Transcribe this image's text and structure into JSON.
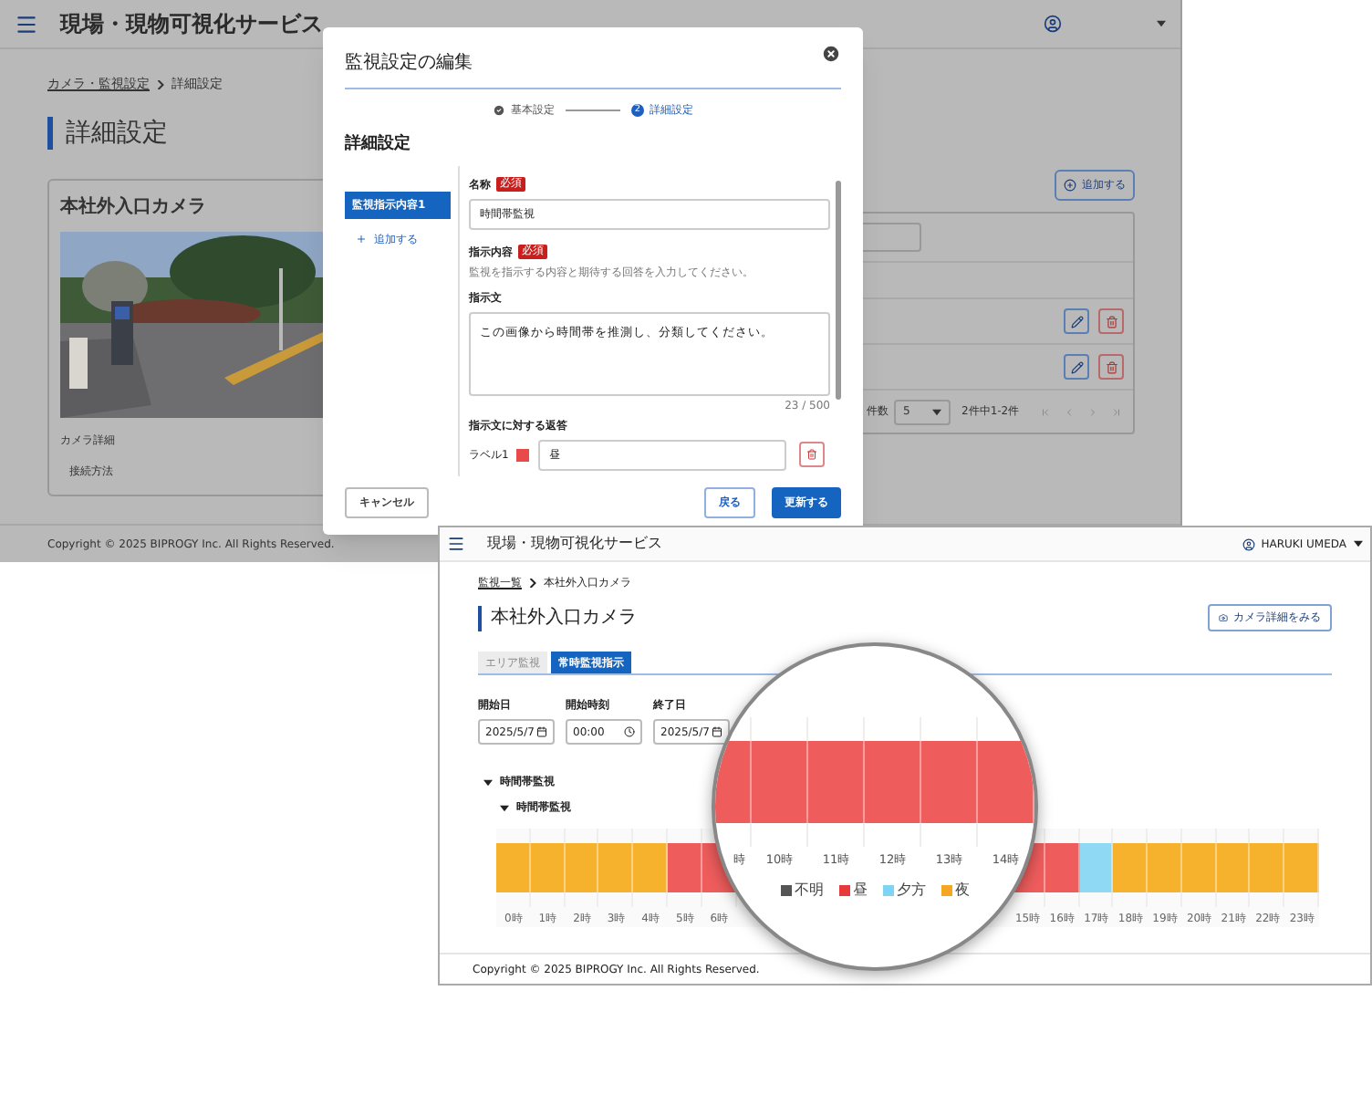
{
  "back_window": {
    "title": "現場・現物可視化サービス",
    "breadcrumb": [
      {
        "label": "カメラ・監視設定",
        "link": true
      },
      {
        "label": "詳細設定",
        "link": false
      }
    ],
    "page_title": "詳細設定",
    "camera_card": {
      "title": "本社外入口カメラ",
      "section": "カメラ詳細",
      "field": "接続方法"
    },
    "add_button": "追加する",
    "rows": [
      {
        "kind": "item"
      },
      {
        "kind": "item"
      }
    ],
    "pagination": {
      "label": "件数",
      "page_size": "5",
      "range": "2件中1-2件"
    },
    "footer": "Copyright © 2025 BIPROGY Inc. All Rights Reserved."
  },
  "dialog": {
    "title": "監視設定の編集",
    "steps": [
      {
        "label": "基本設定",
        "done": true,
        "selected": false
      },
      {
        "label": "詳細設定",
        "number": "2",
        "done": false,
        "selected": true
      }
    ],
    "section_title": "詳細設定",
    "items": [
      {
        "label": "監視指示内容1",
        "selected": true
      }
    ],
    "add_item": "追加する",
    "name_label": "名称",
    "required": "必須",
    "name_value": "時間帯監視",
    "instruction_label": "指示内容",
    "instruction_required": "必須",
    "instruction_hint": "監視を指示する内容と期待する回答を入力してください。",
    "prompt_label": "指示文",
    "prompt_value": "この画像から時間帯を推測し、分類してください。",
    "counter": "23 / 500",
    "answers_label": "指示文に対する返答",
    "answers": [
      {
        "label": "ラベル1",
        "color": "#e84a4a",
        "value": "昼"
      }
    ],
    "buttons": [
      {
        "label": "キャンセル",
        "kind": "outline"
      },
      {
        "label": "戻る",
        "kind": "secondary"
      },
      {
        "label": "更新する",
        "kind": "primary"
      }
    ]
  },
  "front_window": {
    "title": "現場・現物可視化サービス",
    "user": "HARUKI UMEDA",
    "breadcrumb": [
      {
        "label": "監視一覧",
        "link": true
      },
      {
        "label": "本社外入口カメラ",
        "link": false
      }
    ],
    "page_title": "本社外入口カメラ",
    "detail_button": "カメラ詳細をみる",
    "tabs": [
      {
        "label": "エリア監視",
        "selected": false
      },
      {
        "label": "常時監視指示",
        "selected": true
      }
    ],
    "filters": [
      {
        "label": "開始日",
        "value": "2025/5/7",
        "kind": "date"
      },
      {
        "label": "開始時刻",
        "value": "00:00",
        "kind": "time"
      },
      {
        "label": "終了日",
        "value": "2025/5/7",
        "kind": "date"
      }
    ],
    "tree": [
      {
        "label": "時間帯監視",
        "expanded": true,
        "children": [
          {
            "label": "時間帯監視",
            "expanded": true
          }
        ]
      }
    ],
    "timeline_left": [
      {
        "hour": "0時",
        "color": "#f6b22d"
      },
      {
        "hour": "1時",
        "color": "#f6b22d"
      },
      {
        "hour": "2時",
        "color": "#f6b22d"
      },
      {
        "hour": "3時",
        "color": "#f6b22d"
      },
      {
        "hour": "4時",
        "color": "#f6b22d"
      },
      {
        "hour": "5時",
        "color": "#ee5c5c"
      },
      {
        "hour": "6時",
        "color": "#ee5c5c"
      }
    ],
    "timeline_right": [
      {
        "hour": "15時",
        "color": "#ee5c5c"
      },
      {
        "hour": "16時",
        "color": "#ee5c5c"
      },
      {
        "hour": "17時",
        "color": "#90d9f5"
      },
      {
        "hour": "18時",
        "color": "#f6b22d"
      },
      {
        "hour": "19時",
        "color": "#f6b22d"
      },
      {
        "hour": "20時",
        "color": "#f6b22d"
      },
      {
        "hour": "21時",
        "color": "#f6b22d"
      },
      {
        "hour": "22時",
        "color": "#f6b22d"
      },
      {
        "hour": "23時",
        "color": "#f6b22d"
      }
    ],
    "footer": "Copyright © 2025 BIPROGY Inc. All Rights Reserved."
  },
  "magnifier": {
    "segments": [
      {
        "hour": "時",
        "color": "#ee5c5c"
      },
      {
        "hour": "10時",
        "color": "#ee5c5c"
      },
      {
        "hour": "11時",
        "color": "#ee5c5c"
      },
      {
        "hour": "12時",
        "color": "#ee5c5c"
      },
      {
        "hour": "13時",
        "color": "#ee5c5c"
      },
      {
        "hour": "14時",
        "color": "#ee5c5c"
      }
    ],
    "legend": [
      {
        "label": "不明",
        "color": "#555555"
      },
      {
        "label": "昼",
        "color": "#e83a3a"
      },
      {
        "label": "夕方",
        "color": "#7fd3f3"
      },
      {
        "label": "夜",
        "color": "#f5a623"
      }
    ]
  }
}
